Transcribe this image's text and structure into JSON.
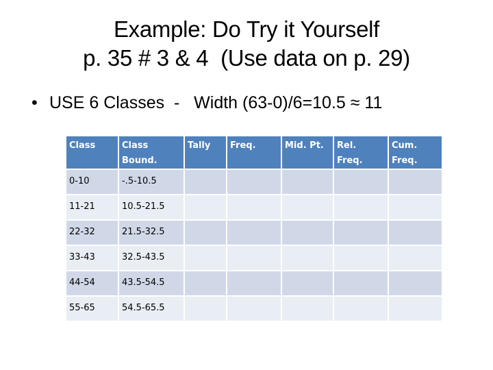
{
  "slide": {
    "title_lines": [
      "Example: Do Try it Yourself",
      "p. 35 # 3 & 4  (Use data on p. 29)"
    ],
    "bullet": {
      "marker": "•",
      "text": "USE 6 Classes  -   Width (63-0)/6=10.5 ≈ 11"
    }
  },
  "table": {
    "header_color": "#4f81bd",
    "row_colors": [
      "#d0d8e8",
      "#e9edf4"
    ],
    "columns": [
      "Class",
      "Class Bound.",
      "Tally",
      "Freq.",
      "Mid. Pt.",
      "Rel. Freq.",
      "Cum. Freq."
    ],
    "rows": [
      [
        "0-10",
        "-.5-10.5",
        "",
        "",
        "",
        "",
        ""
      ],
      [
        "11-21",
        "10.5-21.5",
        "",
        "",
        "",
        "",
        ""
      ],
      [
        "22-32",
        "21.5-32.5",
        "",
        "",
        "",
        "",
        ""
      ],
      [
        "33-43",
        "32.5-43.5",
        "",
        "",
        "",
        "",
        ""
      ],
      [
        "44-54",
        "43.5-54.5",
        "",
        "",
        "",
        "",
        ""
      ],
      [
        "55-65",
        "54.5-65.5",
        "",
        "",
        "",
        "",
        ""
      ]
    ]
  }
}
